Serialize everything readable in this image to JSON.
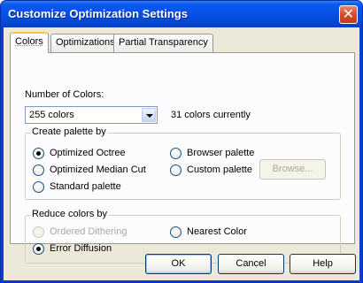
{
  "window": {
    "title": "Customize Optimization Settings",
    "close_glyph": "✕"
  },
  "tabs": [
    {
      "label": "Colors",
      "active": true
    },
    {
      "label": "Optimizations",
      "active": false
    },
    {
      "label": "Partial Transparency",
      "active": false
    }
  ],
  "colors_tab": {
    "num_colors_label": "Number of Colors:",
    "num_colors_value": "255 colors",
    "colors_currently": "31 colors currently",
    "palette_group": {
      "legend": "Create palette by",
      "options": [
        {
          "label": "Optimized Octree",
          "checked": true,
          "enabled": true
        },
        {
          "label": "Optimized Median Cut",
          "checked": false,
          "enabled": true
        },
        {
          "label": "Standard palette",
          "checked": false,
          "enabled": true
        },
        {
          "label": "Browser palette",
          "checked": false,
          "enabled": true
        },
        {
          "label": "Custom palette",
          "checked": false,
          "enabled": true
        }
      ],
      "browse_button": "Browse..."
    },
    "reduce_group": {
      "legend": "Reduce colors by",
      "options": [
        {
          "label": "Ordered Dithering",
          "checked": false,
          "enabled": false
        },
        {
          "label": "Error Diffusion",
          "checked": true,
          "enabled": true
        },
        {
          "label": "Nearest Color",
          "checked": false,
          "enabled": true
        }
      ]
    }
  },
  "buttons": {
    "ok": "OK",
    "cancel": "Cancel",
    "help": "Help"
  },
  "colors": {
    "titlebar": "#0650e6",
    "dialog_bg": "#ece9d8",
    "panel_bg": "#fcfcfe",
    "active_tab_accent": "#ffc83c"
  }
}
